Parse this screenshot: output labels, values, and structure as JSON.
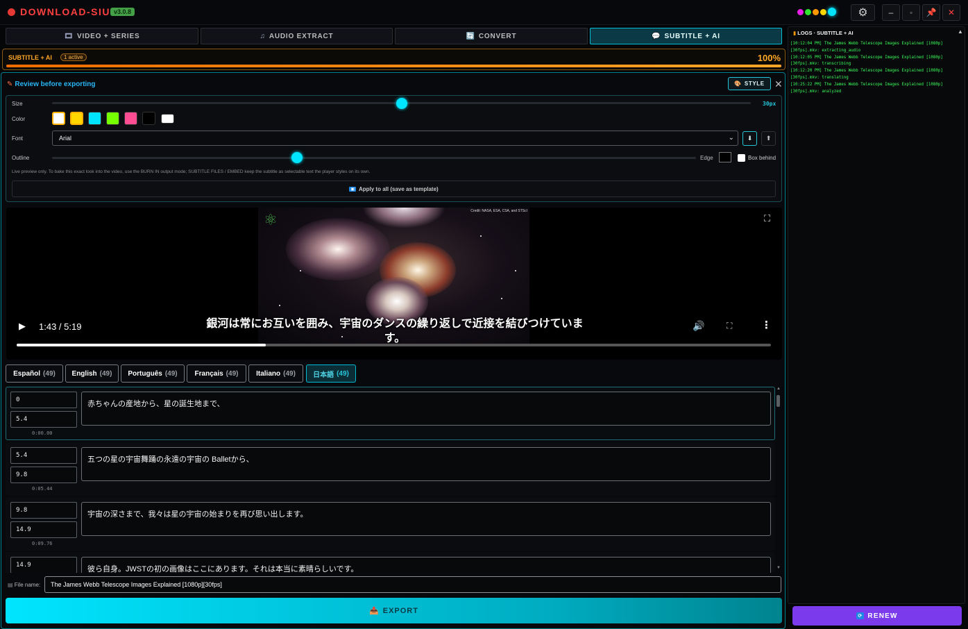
{
  "app": {
    "title": "DOWNLOAD-SIU",
    "version": "v3.0.8"
  },
  "window_controls": {
    "settings_icon": "gear-icon",
    "minimize": "–",
    "maximize": "▫",
    "pin": "📌",
    "close": "✕"
  },
  "theme_colors": [
    "#e91ee6",
    "#2ee62e",
    "#ff9800",
    "#ffd600",
    "#00e5ff"
  ],
  "tabs": [
    {
      "label": "VIDEO + SERIES",
      "icon": "🎞"
    },
    {
      "label": "AUDIO EXTRACT",
      "icon": "♫"
    },
    {
      "label": "CONVERT",
      "icon": "🔄"
    },
    {
      "label": "SUBTITLE + AI",
      "icon": "💬",
      "active": true
    }
  ],
  "progress": {
    "title": "SUBTITLE + AI",
    "badge": "1 active",
    "percent_label": "100%",
    "percent": 100
  },
  "review": {
    "title": "Review before exporting",
    "style_button": "STYLE",
    "size_label": "Size",
    "size_value": "30px",
    "size_level": 0.5,
    "color_label": "Color",
    "colors": [
      "#ffffff",
      "#ffd600",
      "#00e5ff",
      "#76ff03",
      "#ff4d94",
      "#000000",
      "#ffffff"
    ],
    "font_label": "Font",
    "font_value": "Arial",
    "outline_label": "Outline",
    "outline_level": 0.38,
    "edge_label": "Edge",
    "box_behind_label": "Box behind",
    "hint": "Live preview only. To bake this exact look into the video, use the BURN IN output mode; SUBTITLE FILES / EMBED keep the subtitle as selectable text the player styles on its own.",
    "apply_label": "Apply to all (save as template)"
  },
  "video": {
    "credit": "Credit: NASA, ESA, CSA, and STScI",
    "subtitle": "銀河は常にお互いを囲み、宇宙のダンスの繰り返しで近接を結びつけています。",
    "time": "1:43 / 5:19",
    "progress": 0.33
  },
  "languages": [
    {
      "name": "Español",
      "count": "(49)"
    },
    {
      "name": "English",
      "count": "(49)"
    },
    {
      "name": "Português",
      "count": "(49)"
    },
    {
      "name": "Français",
      "count": "(49)"
    },
    {
      "name": "Italiano",
      "count": "(49)"
    },
    {
      "name": "日本語",
      "count": "(49)",
      "active": true
    }
  ],
  "segments": [
    {
      "start": "0",
      "end": "5.4",
      "timestamp": "0:00.00",
      "text": "赤ちゃんの産地から、星の誕生地まで、"
    },
    {
      "start": "5.4",
      "end": "9.8",
      "timestamp": "0:05.44",
      "text": "五つの星の宇宙舞踊の永遠の宇宙の Balletから、"
    },
    {
      "start": "9.8",
      "end": "14.9",
      "timestamp": "0:09.76",
      "text": "宇宙の深さまで、我々は星の宇宙の始まりを再び思い出します。"
    },
    {
      "start": "14.9",
      "end": "",
      "timestamp": "",
      "text": "彼ら自身。JWSTの初の画像はここにあります。それは本当に素晴らしいです。"
    }
  ],
  "file": {
    "label": "File name:",
    "value": "The James Webb Telescope Images Explained [1080p][30fps]"
  },
  "export_label": "EXPORT",
  "logs": {
    "title": "LOGS · SUBTITLE + AI",
    "lines": [
      "[10:12:04 PM] The James Webb Telescope Images Explained [1080p][30fps].mkv: extracting_audio",
      "[10:12:05 PM] The James Webb Telescope Images Explained [1080p][30fps].mkv: transcribing",
      "[10:12:20 PM] The James Webb Telescope Images Explained [1080p][30fps].mkv: translating",
      "[10:25:22 PM] The James Webb Telescope Images Explained [1080p][30fps].mkv: analyzed"
    ]
  },
  "renew_label": "RENEW"
}
